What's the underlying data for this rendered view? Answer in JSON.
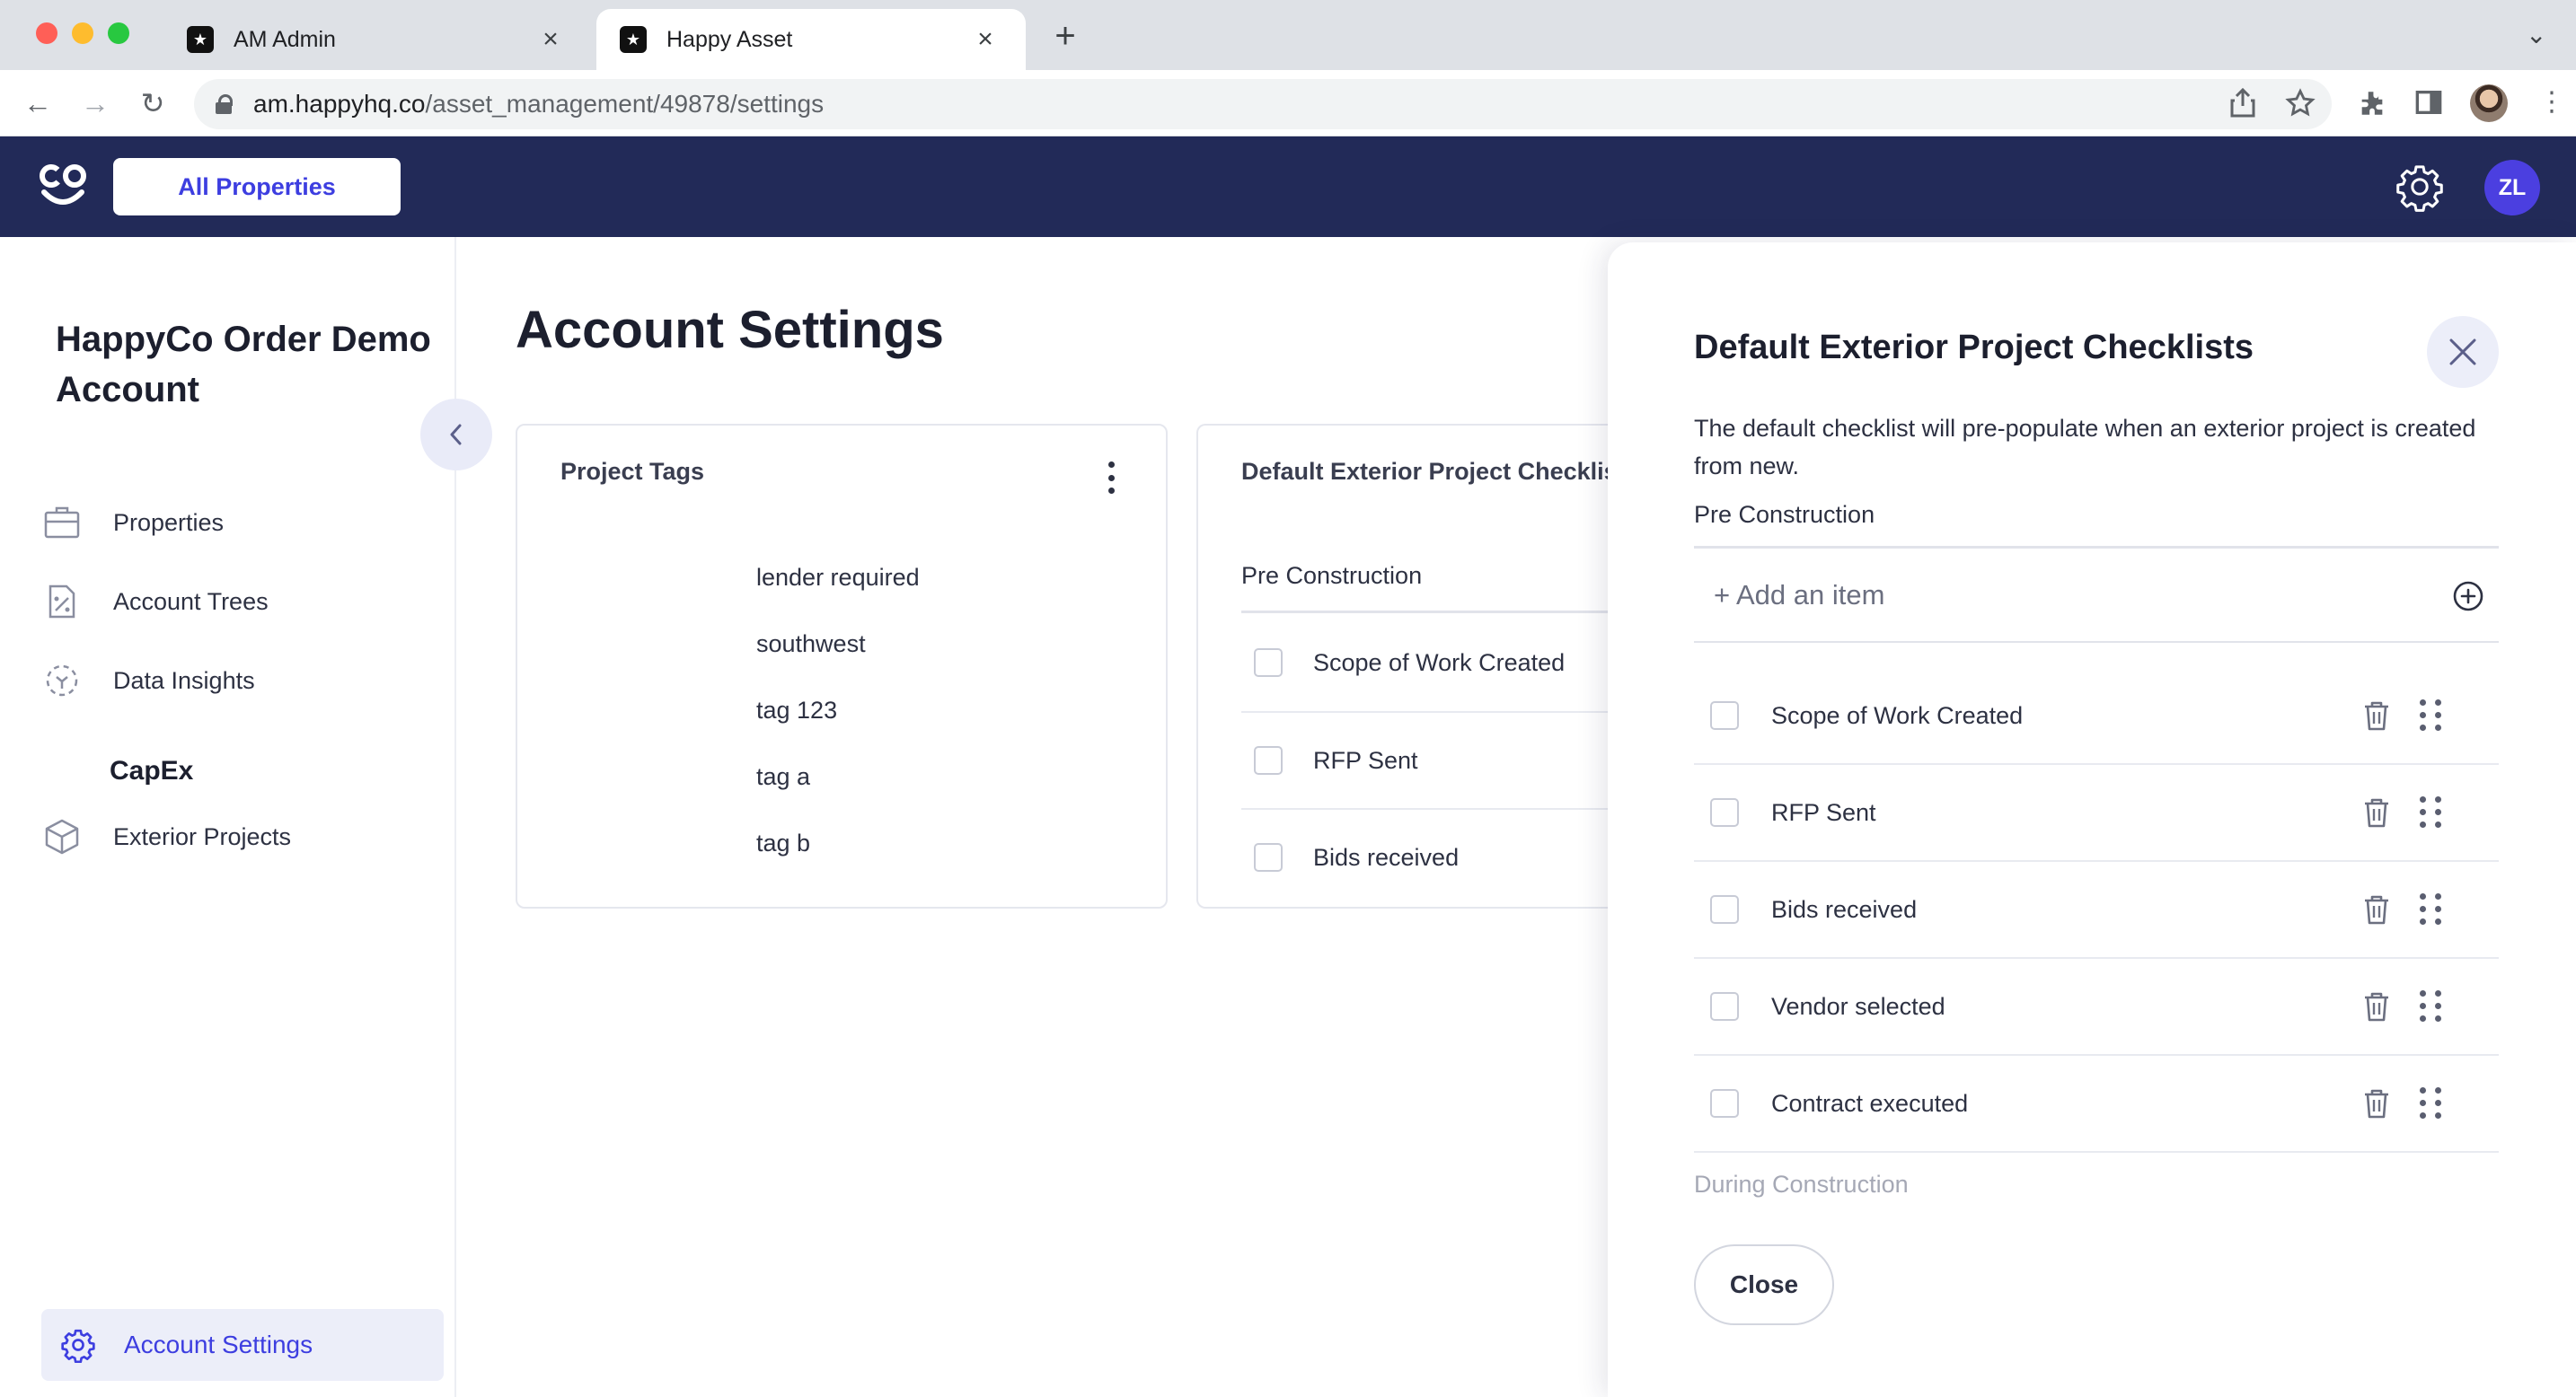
{
  "browser": {
    "tabs": [
      {
        "title": "AM Admin"
      },
      {
        "title": "Happy Asset"
      }
    ],
    "url_host": "am.happyhq.co",
    "url_path": "/asset_management/49878/settings"
  },
  "header": {
    "logo_text": "co",
    "all_properties_label": "All Properties",
    "avatar_initials": "ZL"
  },
  "sidebar": {
    "org_name": "HappyCo Order Demo Account",
    "items": [
      {
        "label": "Properties",
        "icon": "briefcase-icon"
      },
      {
        "label": "Account Trees",
        "icon": "account-tree-icon"
      },
      {
        "label": "Data Insights",
        "icon": "data-insights-icon"
      }
    ],
    "section_label": "CapEx",
    "capex_items": [
      {
        "label": "Exterior Projects",
        "icon": "cube-icon"
      }
    ],
    "footer_item": {
      "label": "Account Settings",
      "icon": "gear-icon"
    }
  },
  "main": {
    "title": "Account Settings",
    "tags_card": {
      "title": "Project Tags",
      "tags": [
        "lender required",
        "southwest",
        "tag 123",
        "tag a",
        "tag b"
      ]
    },
    "checklist_card": {
      "title": "Default Exterior Project Checklists",
      "section": "Pre Construction",
      "items": [
        "Scope of Work Created",
        "RFP Sent",
        "Bids received"
      ]
    }
  },
  "drawer": {
    "title": "Default Exterior Project Checklists",
    "description": "The default checklist will pre-populate when an exterior project is created from new.",
    "section": "Pre Construction",
    "add_placeholder": "+ Add an item",
    "items": [
      "Scope of Work Created",
      "RFP Sent",
      "Bids received",
      "Vendor selected",
      "Contract executed"
    ],
    "next_section": "During Construction",
    "close_label": "Close"
  },
  "colors": {
    "header_bg": "#222a58",
    "accent": "#3d3ee0",
    "avatar_bg": "#4b3fe0"
  }
}
